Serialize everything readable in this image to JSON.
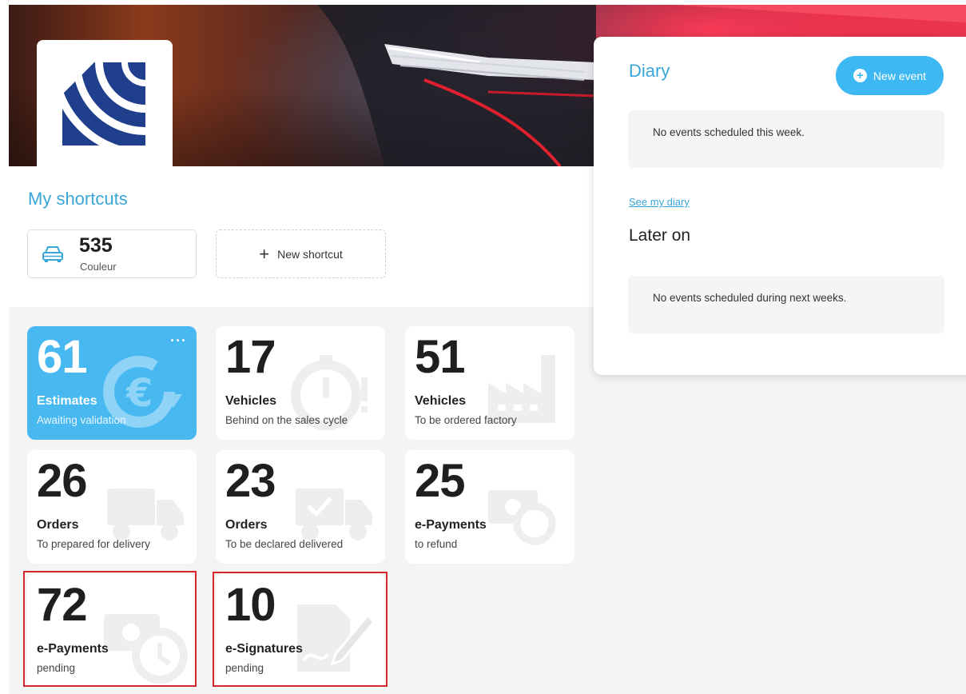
{
  "shortcuts": {
    "title": "My shortcuts",
    "items": [
      {
        "value": "535",
        "label": "Couleur",
        "icon": "car-icon"
      }
    ],
    "new_shortcut_label": "New shortcut"
  },
  "tiles": [
    {
      "value": "61",
      "title": "Estimates",
      "subtitle": "Awaiting validation",
      "icon": "euro-refresh-icon",
      "accent": "#47b8f0",
      "highlighted": false
    },
    {
      "value": "17",
      "title": "Vehicles",
      "subtitle": "Behind on the sales cycle",
      "icon": "stopwatch-icon",
      "highlighted": false
    },
    {
      "value": "51",
      "title": "Vehicles",
      "subtitle": "To be ordered factory",
      "icon": "factory-icon",
      "highlighted": false
    },
    {
      "value": "26",
      "title": "Orders",
      "subtitle": "To prepared for delivery",
      "icon": "truck-icon",
      "highlighted": false
    },
    {
      "value": "23",
      "title": "Orders",
      "subtitle": "To be declared delivered",
      "icon": "truck-check-icon",
      "highlighted": false
    },
    {
      "value": "25",
      "title": "e-Payments",
      "subtitle": "to refund",
      "icon": "money-refund-icon",
      "highlighted": false
    },
    {
      "value": "72",
      "title": "e-Payments",
      "subtitle": "pending",
      "icon": "money-clock-icon",
      "highlighted": true
    },
    {
      "value": "10",
      "title": "e-Signatures",
      "subtitle": "pending",
      "icon": "document-sign-icon",
      "highlighted": true
    }
  ],
  "diary": {
    "title": "Diary",
    "new_event_label": "New event",
    "this_week_empty": "No events scheduled this week.",
    "see_link": "See my diary",
    "later_title": "Later on",
    "later_empty": "No events scheduled during next weeks."
  },
  "colors": {
    "accent": "#3aa6d8",
    "tile_blue": "#47b8f0",
    "highlight": "#d8262c",
    "logo_navy": "#1f3e8c"
  }
}
